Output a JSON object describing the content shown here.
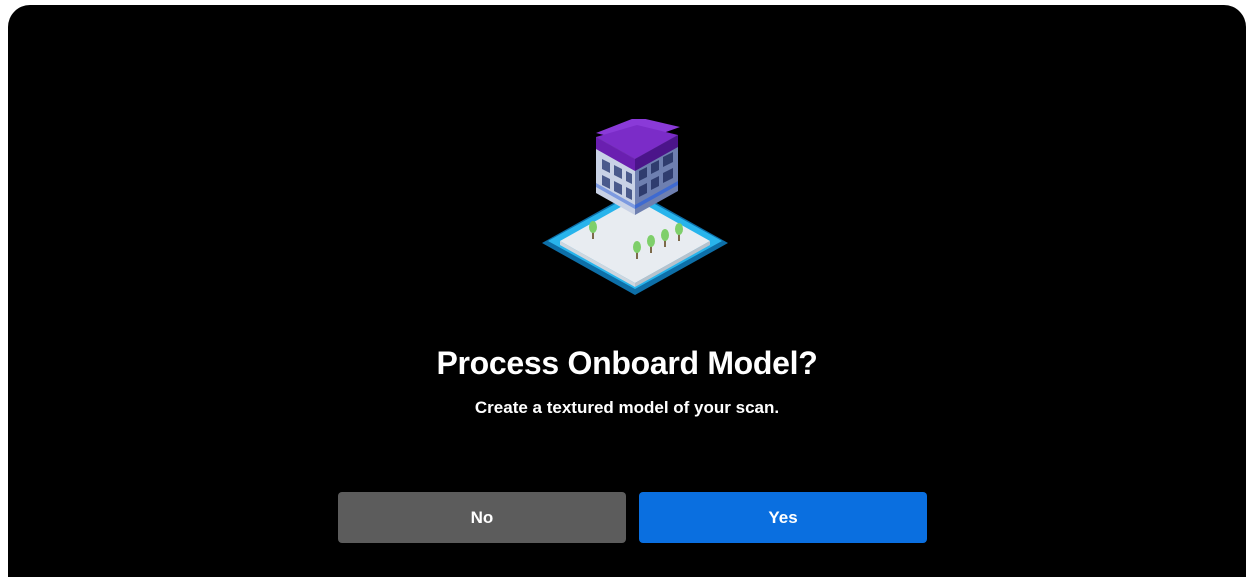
{
  "dialog": {
    "title": "Process Onboard Model?",
    "subtitle": "Create a textured model of your scan.",
    "illustration_icon": "building-model-icon",
    "buttons": {
      "no_label": "No",
      "yes_label": "Yes"
    }
  },
  "colors": {
    "background": "#000000",
    "no_button": "#5c5c5c",
    "yes_button": "#0a6fe0",
    "building_roof": "#6a1fb0",
    "base_plate": "#1e9fe0"
  }
}
